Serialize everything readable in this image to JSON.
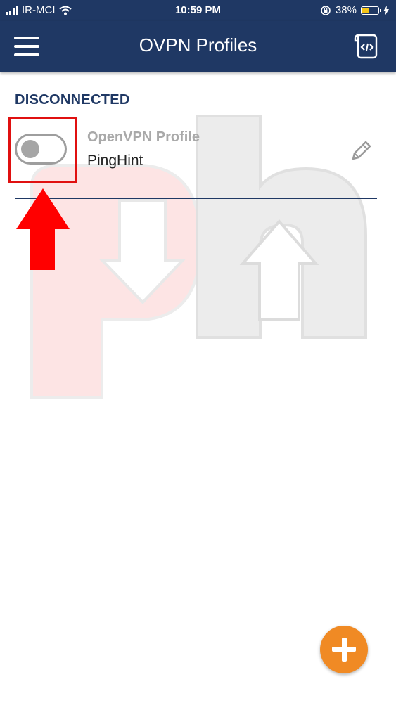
{
  "status_bar": {
    "carrier": "IR-MCI",
    "time": "10:59 PM",
    "battery_percent": "38%",
    "battery_level": 0.38,
    "icons": [
      "signal-icon",
      "wifi-icon",
      "orientation-lock-icon",
      "battery-icon",
      "charging-icon"
    ]
  },
  "header": {
    "title": "OVPN Profiles",
    "left_icon": "hamburger-menu-icon",
    "right_icon": "import-file-icon"
  },
  "section": {
    "title": "DISCONNECTED"
  },
  "profile": {
    "name": "OpenVPN Profile",
    "server": "PingHint",
    "connected": false,
    "edit_icon": "pencil-icon"
  },
  "fab": {
    "icon": "plus-icon"
  },
  "annotation": {
    "highlight_color": "#e01010",
    "arrow_color": "#ff0000"
  },
  "colors": {
    "header_bg": "#1f3864",
    "section_title": "#1f3864",
    "fab_bg": "#f08a24",
    "toggle_off": "#9e9e9e"
  }
}
